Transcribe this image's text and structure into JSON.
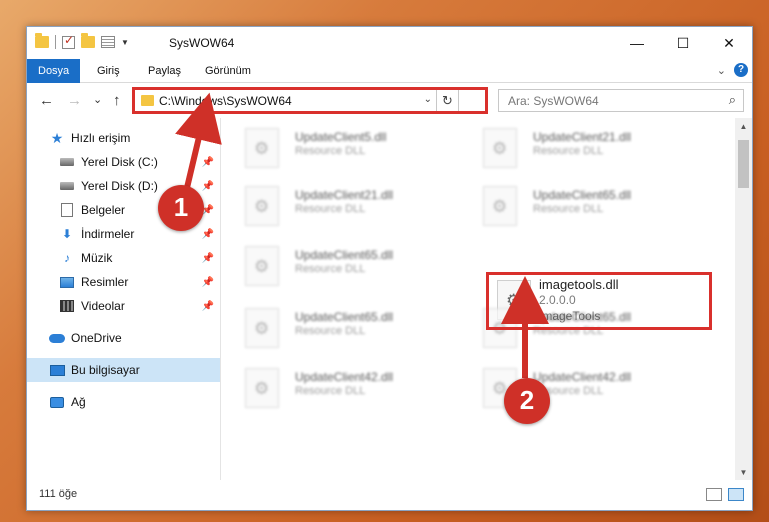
{
  "window": {
    "title": "SysWOW64",
    "controls": {
      "minimize": "—",
      "maximize": "☐",
      "close": "✕"
    }
  },
  "ribbon": {
    "tabs": [
      {
        "label": "Dosya",
        "active": true
      },
      {
        "label": "Giriş"
      },
      {
        "label": "Paylaş"
      },
      {
        "label": "Görünüm"
      }
    ],
    "expand_icon": "chevron-down-icon",
    "help_label": "?"
  },
  "navigation": {
    "back": "←",
    "forward": "→",
    "recent": "⌄",
    "up": "↑",
    "address": "C:\\Windows\\SysWOW64",
    "address_dropdown": "⌄",
    "refresh": "↻",
    "search_placeholder": "Ara: SysWOW64",
    "search_icon": "⌕"
  },
  "sidebar": {
    "items": [
      {
        "label": "Hızlı erişim",
        "icon": "star-icon",
        "pinned": false
      },
      {
        "label": "Yerel Disk (C:)",
        "icon": "disk-icon",
        "pinned": true
      },
      {
        "label": "Yerel Disk (D:)",
        "icon": "disk-icon",
        "pinned": true
      },
      {
        "label": "Belgeler",
        "icon": "document-icon",
        "pinned": true
      },
      {
        "label": "İndirmeler",
        "icon": "download-icon",
        "pinned": true
      },
      {
        "label": "Müzik",
        "icon": "music-icon",
        "pinned": true
      },
      {
        "label": "Resimler",
        "icon": "pictures-icon",
        "pinned": true
      },
      {
        "label": "Videolar",
        "icon": "videos-icon",
        "pinned": true
      },
      {
        "label": "OneDrive",
        "icon": "cloud-icon",
        "pinned": false
      },
      {
        "label": "Bu bilgisayar",
        "icon": "computer-icon",
        "pinned": false,
        "selected": true
      },
      {
        "label": "Ağ",
        "icon": "network-icon",
        "pinned": false
      }
    ]
  },
  "files": [
    {
      "name": "UpdateClient5.dll",
      "sub": "Resource DLL"
    },
    {
      "name": "UpdateClient21.dll",
      "sub": "Resource DLL"
    },
    {
      "name": "UpdateClient21.dll",
      "sub": "Resource DLL"
    },
    {
      "name": "UpdateClient65.dll",
      "sub": "Resource DLL"
    },
    {
      "name": "UpdateClient65.dll",
      "sub": "Resource DLL"
    },
    {
      "name": "imagetools.dll",
      "sub": "2.0.0.0",
      "sub2": "ImageTools"
    },
    {
      "name": "UpdateClient65.dll",
      "sub": "Resource DLL"
    },
    {
      "name": "UpdateClient65.dll",
      "sub": "Resource DLL"
    },
    {
      "name": "UpdateClient42.dll",
      "sub": "Resource DLL"
    },
    {
      "name": "UpdateClient42.dll",
      "sub": "Resource DLL"
    }
  ],
  "status": {
    "count": "111 öğe"
  },
  "annotations": {
    "step1": "1",
    "step2": "2",
    "color": "#cf3028"
  }
}
